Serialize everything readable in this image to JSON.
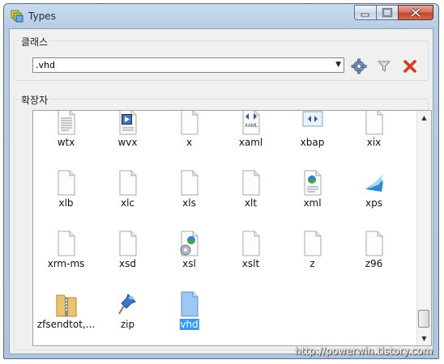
{
  "window": {
    "title": "Types"
  },
  "group_classes": {
    "label": "클래스"
  },
  "combo": {
    "value": ".vhd"
  },
  "group_extensions": {
    "label": "확장자"
  },
  "files": [
    {
      "name": "wtx",
      "icon": "text-doc-icon"
    },
    {
      "name": "wvx",
      "icon": "media-playlist-icon"
    },
    {
      "name": "x",
      "icon": "blank-file-icon"
    },
    {
      "name": "xaml",
      "icon": "xaml-icon"
    },
    {
      "name": "xbap",
      "icon": "xbap-icon"
    },
    {
      "name": "xix",
      "icon": "blank-file-icon"
    },
    {
      "name": "xlb",
      "icon": "blank-file-icon"
    },
    {
      "name": "xlc",
      "icon": "blank-file-icon"
    },
    {
      "name": "xls",
      "icon": "blank-file-icon"
    },
    {
      "name": "xlt",
      "icon": "blank-file-icon"
    },
    {
      "name": "xml",
      "icon": "xml-doc-icon"
    },
    {
      "name": "xps",
      "icon": "xps-doc-icon"
    },
    {
      "name": "xrm-ms",
      "icon": "blank-file-icon"
    },
    {
      "name": "xsd",
      "icon": "blank-file-icon"
    },
    {
      "name": "xsl",
      "icon": "xsl-gear-icon"
    },
    {
      "name": "xslt",
      "icon": "blank-file-icon"
    },
    {
      "name": "z",
      "icon": "blank-file-icon"
    },
    {
      "name": "z96",
      "icon": "blank-file-icon"
    },
    {
      "name": "zfsendtot,...",
      "icon": "zip-folder-icon"
    },
    {
      "name": "zip",
      "icon": "pushpin-icon"
    },
    {
      "name": "vhd",
      "icon": "blank-file-selected-icon",
      "selected": true
    }
  ],
  "watermark": "http://powerwin.tistory.com"
}
